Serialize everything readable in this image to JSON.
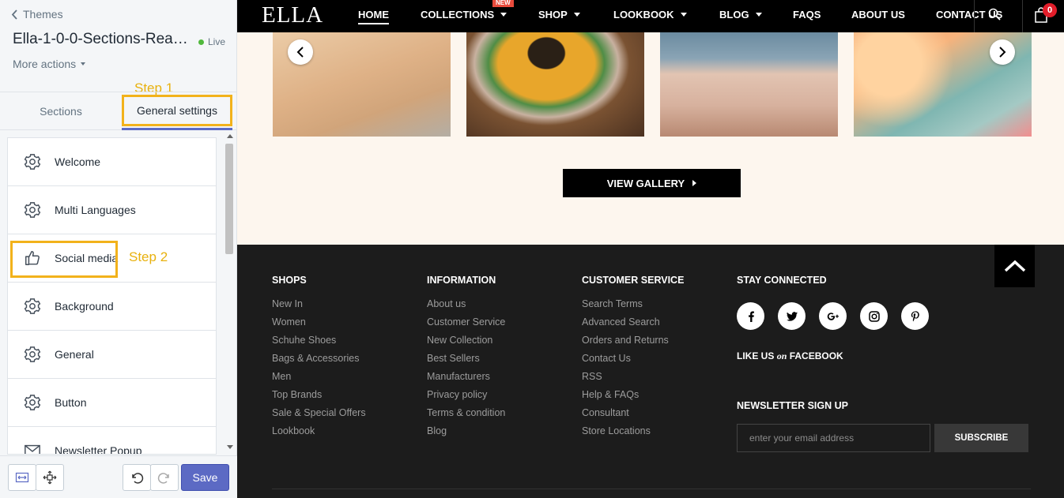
{
  "editor": {
    "back_label": "Themes",
    "theme_title": "Ella-1-0-0-Sections-Rea…",
    "live_label": "Live",
    "more_actions": "More actions",
    "step1": "Step 1",
    "step2": "Step 2",
    "tabs": [
      {
        "label": "Sections",
        "active": false
      },
      {
        "label": "General settings",
        "active": true
      }
    ],
    "settings": [
      {
        "label": "Welcome",
        "icon": "gear-icon"
      },
      {
        "label": "Multi Languages",
        "icon": "gear-icon"
      },
      {
        "label": "Social media",
        "icon": "thumbs-up-icon"
      },
      {
        "label": "Background",
        "icon": "gear-icon"
      },
      {
        "label": "General",
        "icon": "gear-icon"
      },
      {
        "label": "Button",
        "icon": "gear-icon"
      },
      {
        "label": "Newsletter Popup",
        "icon": "envelope-icon"
      }
    ],
    "save_label": "Save",
    "accent_color": "#5c6ac4",
    "highlight_color": "#f2b21b"
  },
  "site": {
    "logo": "ELLA",
    "nav": [
      {
        "label": "HOME",
        "dropdown": false
      },
      {
        "label": "COLLECTIONS",
        "dropdown": true,
        "badge": "NEW"
      },
      {
        "label": "SHOP",
        "dropdown": true
      },
      {
        "label": "LOOKBOOK",
        "dropdown": true
      },
      {
        "label": "BLOG",
        "dropdown": true
      },
      {
        "label": "FAQS",
        "dropdown": false
      },
      {
        "label": "ABOUT US",
        "dropdown": false
      },
      {
        "label": "CONTACT US",
        "dropdown": false
      }
    ],
    "cart_count": "0",
    "view_gallery": "VIEW GALLERY",
    "footer": {
      "shops": {
        "title": "SHOPS",
        "links": [
          "New In",
          "Women",
          "Schuhe Shoes",
          "Bags & Accessories",
          "Men",
          "Top Brands",
          "Sale & Special Offers",
          "Lookbook"
        ]
      },
      "information": {
        "title": "INFORMATION",
        "links": [
          "About us",
          "Customer Service",
          "New Collection",
          "Best Sellers",
          "Manufacturers",
          "Privacy policy",
          "Terms & condition",
          "Blog"
        ]
      },
      "customer_service": {
        "title": "CUSTOMER SERVICE",
        "links": [
          "Search Terms",
          "Advanced Search",
          "Orders and Returns",
          "Contact Us",
          "RSS",
          "Help & FAQs",
          "Consultant",
          "Store Locations"
        ]
      },
      "stay_connected": {
        "title": "STAY CONNECTED",
        "socials": [
          "facebook-icon",
          "twitter-icon",
          "google-plus-icon",
          "instagram-icon",
          "pinterest-icon"
        ],
        "like_prefix": "LIKE US",
        "like_on": "on",
        "like_suffix": "FACEBOOK"
      },
      "newsletter": {
        "title": "NEWSLETTER SIGN UP",
        "placeholder": "enter your email address",
        "button": "SUBSCRIBE"
      }
    }
  }
}
